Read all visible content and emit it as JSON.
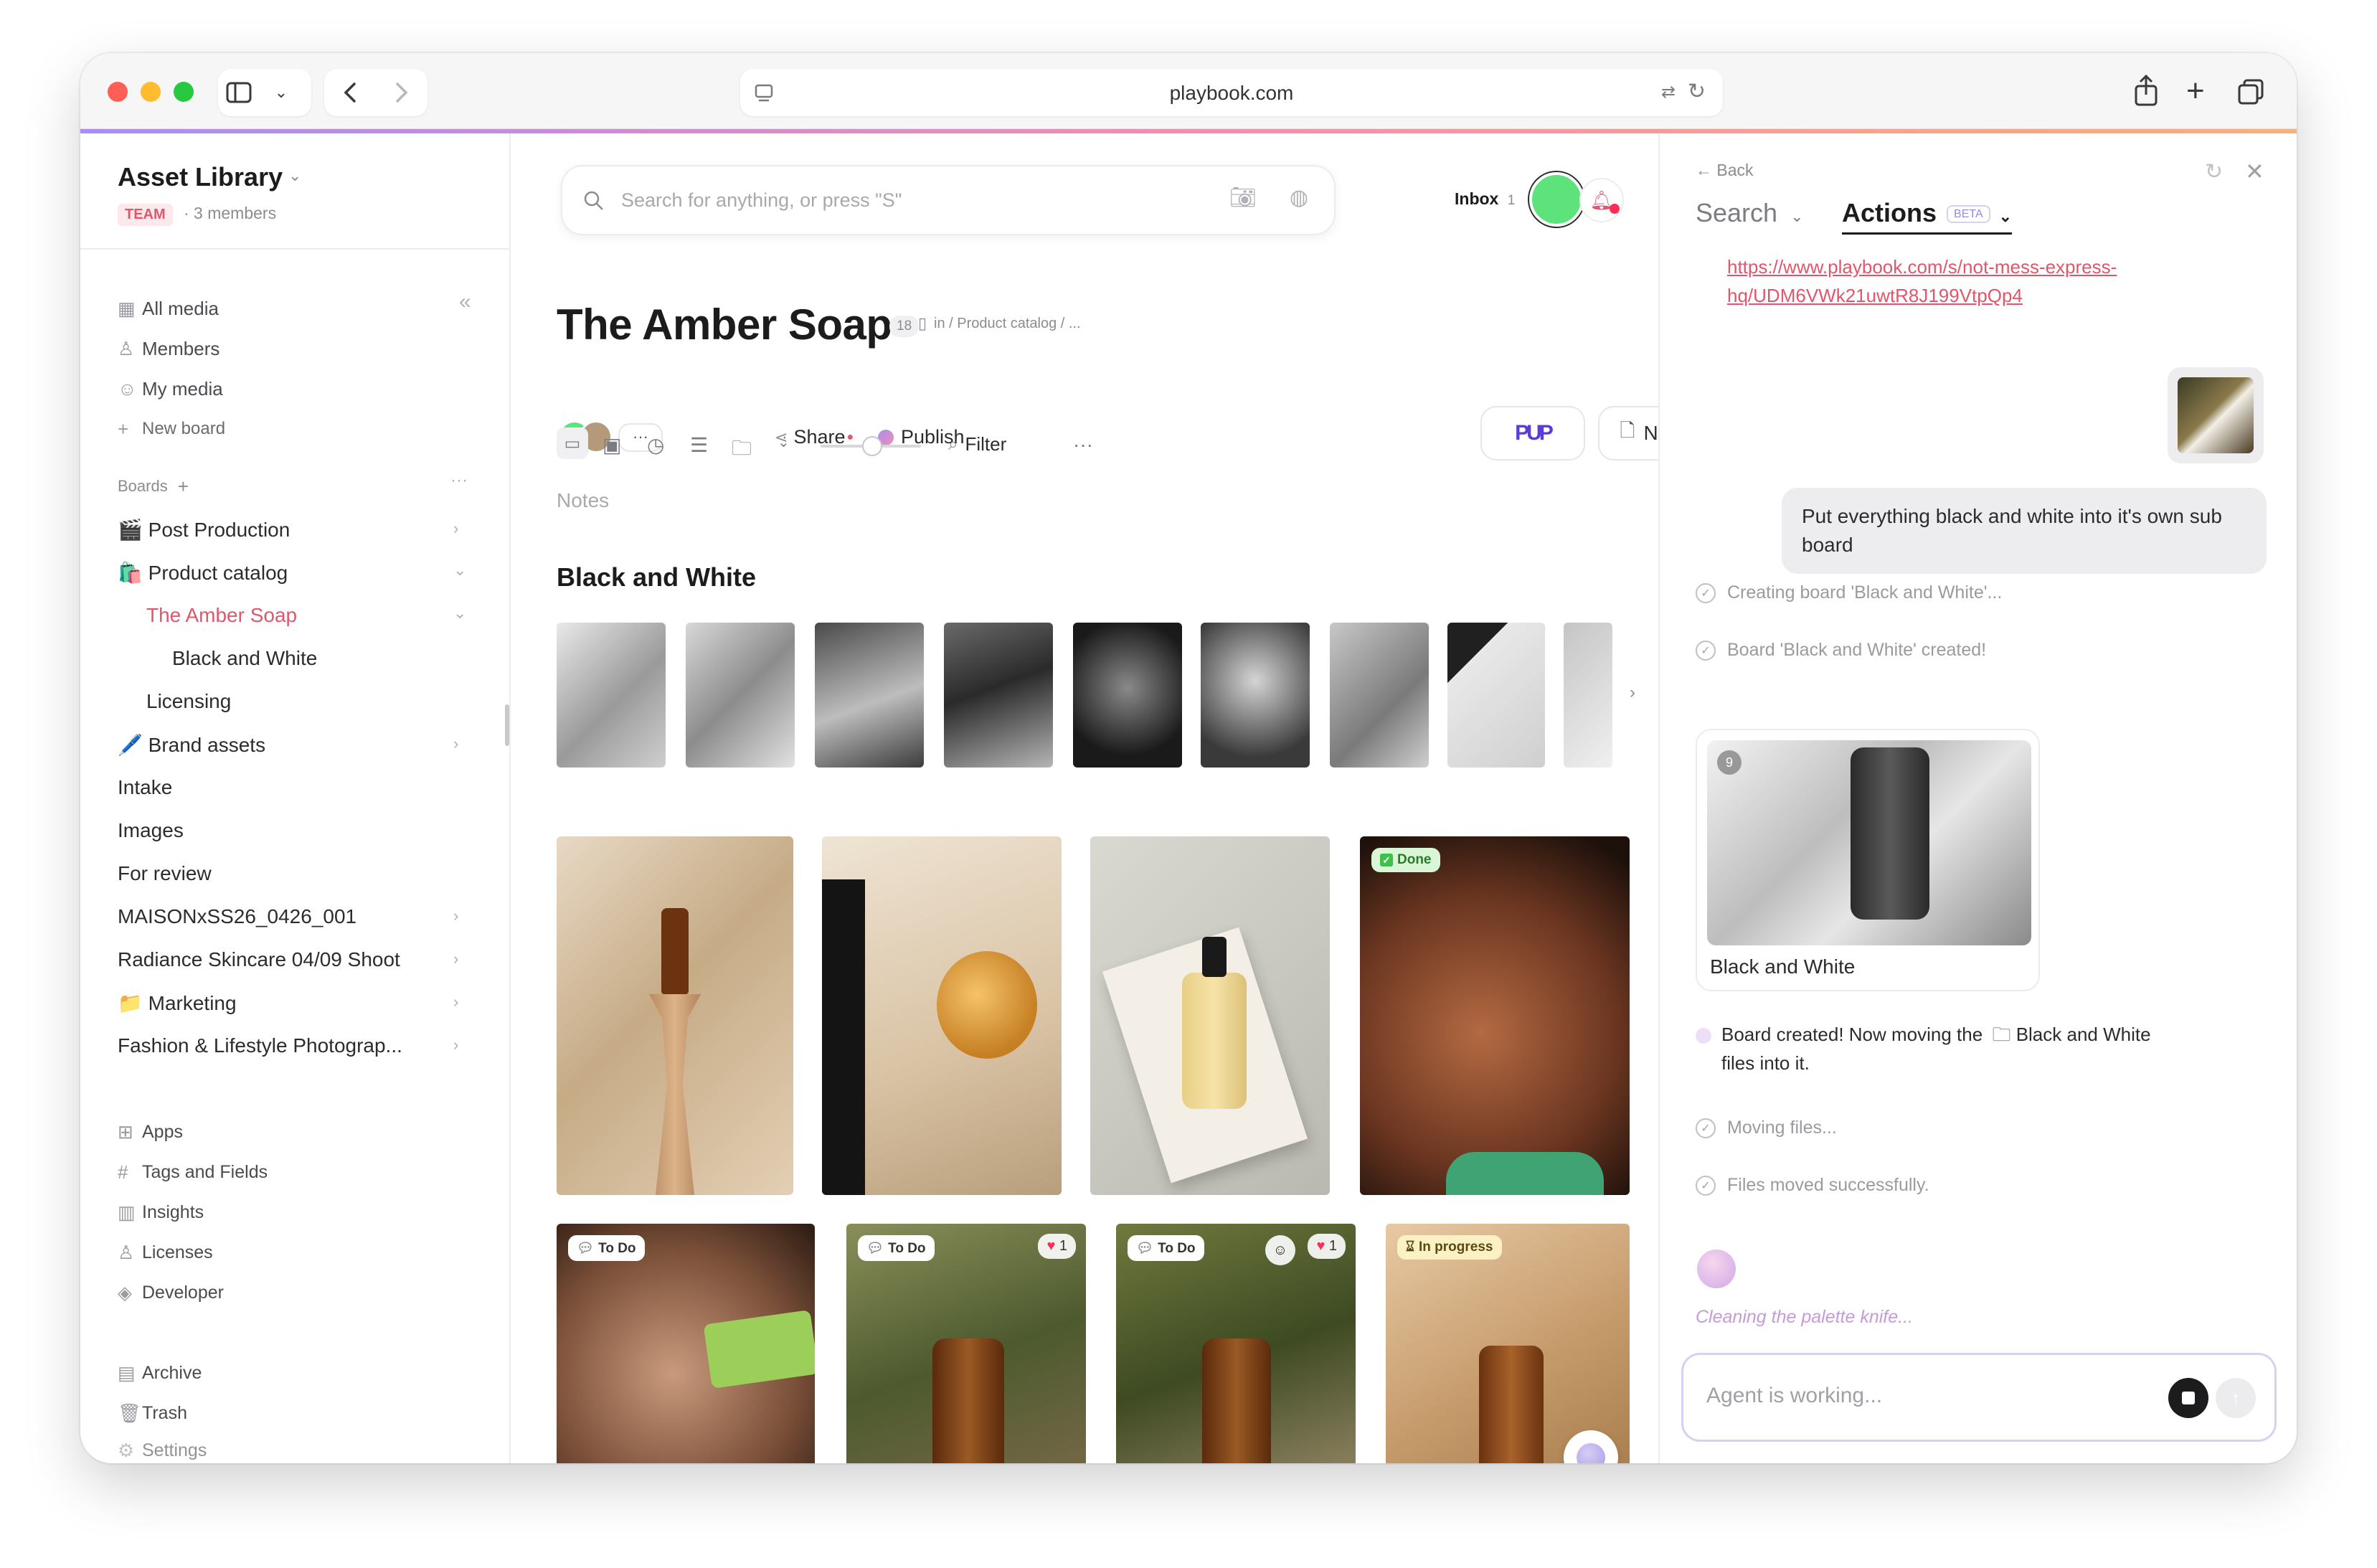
{
  "browser": {
    "url": "playbook.com"
  },
  "sidebar": {
    "title": "Asset Library",
    "team_badge": "TEAM",
    "member_count": "· 3 members",
    "top_items": [
      {
        "label": "All media",
        "icon": "grid-icon"
      },
      {
        "label": "Members",
        "icon": "person-icon"
      },
      {
        "label": "My media",
        "icon": "smile-icon"
      },
      {
        "label": "New board",
        "icon": "plus-icon"
      }
    ],
    "boards_header": "Boards",
    "boards": [
      {
        "label": "🎬 Post Production"
      },
      {
        "label": "🛍️ Product catalog"
      },
      {
        "label": "The Amber Soap"
      },
      {
        "label": "Black and White"
      },
      {
        "label": "Licensing"
      },
      {
        "label": "🖊️ Brand assets"
      },
      {
        "label": "Intake"
      },
      {
        "label": "Images"
      },
      {
        "label": "For review"
      },
      {
        "label": "MAISONxSS26_0426_001"
      },
      {
        "label": "Radiance Skincare 04/09 Shoot"
      },
      {
        "label": "📁 Marketing"
      },
      {
        "label": "Fashion & Lifestyle Photograp..."
      }
    ],
    "bottom_items": [
      {
        "label": "Apps"
      },
      {
        "label": "Tags and Fields"
      },
      {
        "label": "Insights"
      },
      {
        "label": "Licenses"
      },
      {
        "label": "Developer"
      },
      {
        "label": "Archive"
      },
      {
        "label": "Trash"
      },
      {
        "label": "Settings"
      }
    ]
  },
  "main": {
    "search_placeholder": "Search for anything, or press \"S\"",
    "inbox_label": "Inbox",
    "inbox_count": "1",
    "title": "The Amber Soap",
    "item_count": "18",
    "breadcrumb": "in / Product catalog / ...",
    "share_label": "Share",
    "publish_label": "Publish",
    "new_label": "New",
    "filter_label": "Filter",
    "notes_placeholder": "Notes",
    "section_title": "Black and White",
    "tags": {
      "done": "Done",
      "todo": "To Do",
      "in_progress": "In progress"
    },
    "likes": "1"
  },
  "panel": {
    "back_label": "Back",
    "tab_search": "Search",
    "tab_actions": "Actions",
    "beta_badge": "BETA",
    "link_text": "https://www.playbook.com/s/not-mess-express-hq/UDM6VWk21uwtR8J199VtpQp4",
    "user_message": "Put everything black and white into it's own sub board",
    "status_creating": "Creating board 'Black and White'...",
    "status_created": "Board 'Black and White' created!",
    "board_card_count": "9",
    "board_card_title": "Black and White",
    "moving_msg_pre": "Board created! Now moving the",
    "moving_msg_board": "Black and White",
    "moving_msg_post": "files into it.",
    "status_moving": "Moving files...",
    "status_moved": "Files moved successfully.",
    "thinking_text": "Cleaning the palette knife...",
    "composer_placeholder": "Agent is working..."
  }
}
